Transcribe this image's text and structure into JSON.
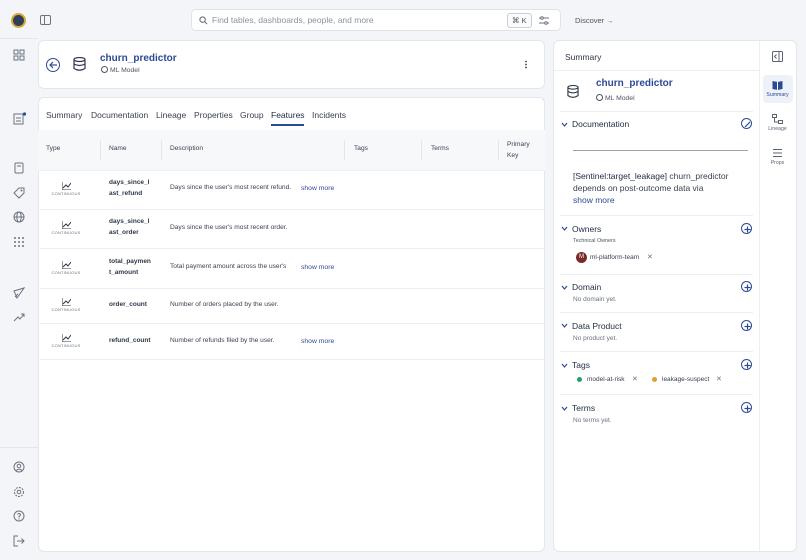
{
  "topbar": {
    "search_placeholder": "Find tables, dashboards, people, and more",
    "shortcut": "⌘ K",
    "discover": "Discover"
  },
  "header": {
    "title": "churn_predictor",
    "type_label": "ML Model"
  },
  "tabs": [
    "Summary",
    "Documentation",
    "Lineage",
    "Properties",
    "Group",
    "Features",
    "Incidents"
  ],
  "active_tab": "Features",
  "table": {
    "columns": [
      "Type",
      "Name",
      "Description",
      "Tags",
      "Terms",
      "Primary",
      "Key"
    ],
    "type_label": "CONTINUOUS",
    "show_more": "show more",
    "rows": [
      {
        "name_l1": "days_since_l",
        "name_l2": "ast_refund",
        "description": "Days since the user's most recent refund."
      },
      {
        "name_l1": "days_since_l",
        "name_l2": "ast_order",
        "description": "Days since the user's most recent order."
      },
      {
        "name_l1": "total_paymen",
        "name_l2": "t_amount",
        "description": "Total payment amount across the user's"
      },
      {
        "name_l1": "order_count",
        "name_l2": "",
        "description": "Number of orders placed by the user."
      },
      {
        "name_l1": "refund_count",
        "name_l2": "",
        "description": "Number of refunds filed by the user."
      }
    ]
  },
  "panel": {
    "heading": "Summary",
    "title": "churn_predictor",
    "type_label": "ML Model",
    "documentation": {
      "label": "Documentation",
      "line1_tag": "[Sentinel:target_leakage]",
      "line1_rest": "churn_predictor",
      "line2": "depends on post-outcome data via",
      "show_more": "show more"
    },
    "owners": {
      "label": "Owners",
      "sub": "Technical Owners",
      "avatar": "M",
      "owner": "ml-platform-team"
    },
    "domain": {
      "label": "Domain",
      "empty": "No domain yet."
    },
    "data_product": {
      "label": "Data Product",
      "empty": "No product yet."
    },
    "tags": {
      "label": "Tags",
      "items": [
        "model-at-risk",
        "leakage-suspect"
      ],
      "colors": [
        "#22a06b",
        "#e0a030"
      ]
    },
    "terms": {
      "label": "Terms",
      "empty": "No terms yet."
    }
  },
  "side_tabs": [
    "Summary",
    "Lineage",
    "Props"
  ]
}
